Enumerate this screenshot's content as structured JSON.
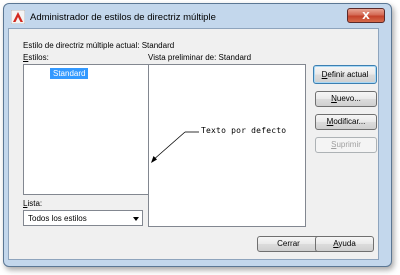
{
  "window": {
    "title": "Administrador de estilos de directriz múltiple"
  },
  "titlebar": {
    "close_glyph": "X"
  },
  "current_style": {
    "label": "Estilo de directriz múltiple actual: Standard"
  },
  "styles": {
    "label_prefix": "E",
    "label_rest": "stilos:",
    "items": [
      "Standard"
    ],
    "selected": "Standard"
  },
  "preview": {
    "label": "Vista preliminar de: Standard",
    "leader_text": "Texto por defecto"
  },
  "list_filter": {
    "label_prefix": "L",
    "label_rest": "ista:",
    "value": "Todos los estilos"
  },
  "buttons": {
    "set_current": {
      "pre": "",
      "mn": "D",
      "post": "efinir actual"
    },
    "new": {
      "pre": "",
      "mn": "N",
      "post": "uevo..."
    },
    "modify": {
      "pre": "",
      "mn": "M",
      "post": "odificar..."
    },
    "delete": {
      "pre": "",
      "mn": "S",
      "post": "uprimir"
    },
    "close": {
      "label": "Cerrar"
    },
    "help": {
      "pre": "",
      "mn": "A",
      "post": "yuda"
    }
  },
  "colors": {
    "title_gradient": "#c3d7ec",
    "selection": "#3399ff",
    "close_button": "#c4422b"
  }
}
